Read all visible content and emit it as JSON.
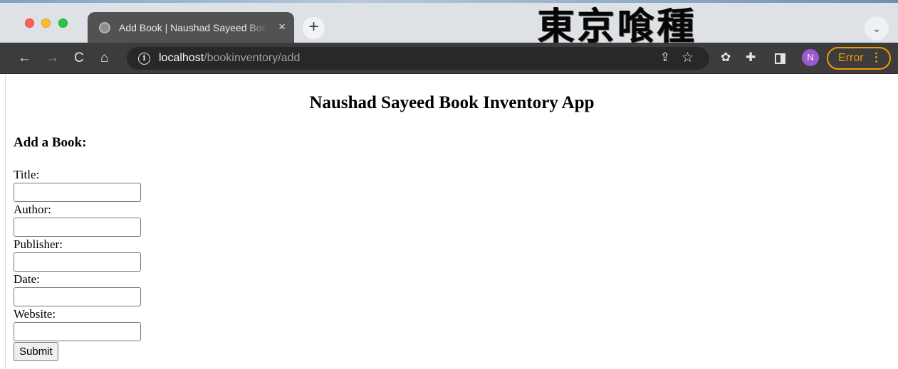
{
  "browser": {
    "tab": {
      "title": "Add Book | Naushad Sayeed Book Inventory App",
      "close_glyph": "×"
    },
    "new_tab_glyph": "+",
    "tab_search_glyph": "⌄",
    "banner_text": "東京喰種",
    "nav": {
      "back_glyph": "←",
      "forward_glyph": "→",
      "reload_glyph": "C",
      "home_glyph": "⌂"
    },
    "url": {
      "host": "localhost",
      "path": "/bookinventory/add"
    },
    "profile_initial": "N",
    "error_label": "Error",
    "error_menu_glyph": "⋮"
  },
  "page": {
    "app_title": "Naushad Sayeed Book Inventory App",
    "form_heading": "Add a Book:",
    "fields": [
      {
        "label": "Title:",
        "value": ""
      },
      {
        "label": "Author:",
        "value": ""
      },
      {
        "label": "Publisher:",
        "value": ""
      },
      {
        "label": "Date:",
        "value": ""
      },
      {
        "label": "Website:",
        "value": ""
      }
    ],
    "submit_label": "Submit"
  },
  "icons": [
    "globe-icon",
    "close-icon",
    "plus-icon",
    "chevron-down-icon",
    "back-arrow-icon",
    "forward-arrow-icon",
    "reload-icon",
    "home-icon",
    "info-icon",
    "share-icon",
    "star-icon",
    "extension-icon",
    "puzzle-icon",
    "side-panel-icon",
    "kebab-menu-icon"
  ],
  "colors": {
    "error_accent": "#f29900",
    "avatar_bg": "#9b59d0",
    "toolbar_bg": "#3c3c3c",
    "tab_bg": "#525252"
  }
}
